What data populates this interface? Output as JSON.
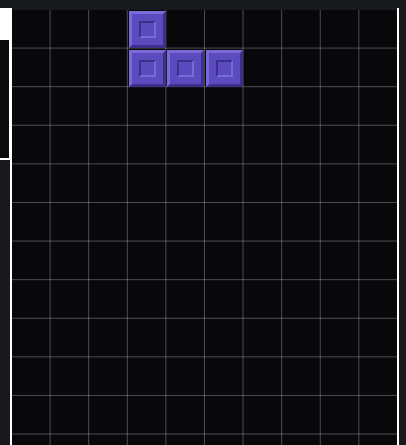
{
  "board": {
    "columns": 10,
    "rows": 11,
    "background": "#08080a",
    "grid_color": "#ffffff"
  },
  "active_piece": {
    "shape": "J",
    "color": "#5b4bbf",
    "cells": [
      {
        "col": 3,
        "row": 0
      },
      {
        "col": 3,
        "row": 1
      },
      {
        "col": 4,
        "row": 1
      },
      {
        "col": 5,
        "row": 1
      }
    ]
  }
}
